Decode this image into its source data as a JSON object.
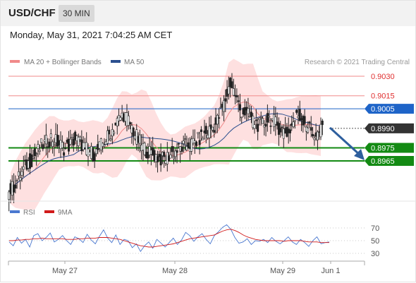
{
  "header": {
    "symbol": "USD/CHF",
    "timeframe": "30 MIN"
  },
  "timestamp": "Monday, May 31, 2021 7:04:25 AM CET",
  "legend": {
    "ma20": "MA 20 + Bollinger Bands",
    "ma50": "MA 50"
  },
  "credit": "Research © 2021 Trading Central",
  "rsi_legend": {
    "rsi": "RSI",
    "ma": "9MA"
  },
  "colors": {
    "resistance": "#f08a8a",
    "pivot_blue": "#1e64c8",
    "support": "#138a13",
    "bollinger": "#fdd5d5",
    "ma20": "#f08a8a",
    "ma50": "#2b4f8f",
    "up": "#1e1e1e",
    "arrow": "#2e5f9e"
  },
  "chart_data": [
    {
      "type": "candlestick",
      "title": "USD/CHF",
      "timeframe": "30 MIN",
      "ylim": [
        0.8935,
        0.904
      ],
      "x_ticks": [
        "May 27",
        "May 28",
        "May 29",
        "Jun 1"
      ],
      "levels": [
        {
          "label": "0.9030",
          "value": 0.903,
          "kind": "resistance"
        },
        {
          "label": "0.9015",
          "value": 0.9015,
          "kind": "resistance"
        },
        {
          "label": "0.9005",
          "value": 0.9005,
          "kind": "pivot"
        },
        {
          "label": "0.8990",
          "value": 0.899,
          "kind": "last"
        },
        {
          "label": "0.8975",
          "value": 0.8975,
          "kind": "support"
        },
        {
          "label": "0.8965",
          "value": 0.8965,
          "kind": "support"
        }
      ],
      "last_price": 0.899,
      "series": [
        {
          "name": "MA 20 + Bollinger Bands"
        },
        {
          "name": "MA 50"
        }
      ],
      "close": [
        0.8944,
        0.895,
        0.8956,
        0.8962,
        0.8966,
        0.8971,
        0.8976,
        0.8979,
        0.8983,
        0.898,
        0.8977,
        0.8974,
        0.8978,
        0.8982,
        0.8979,
        0.8975,
        0.8972,
        0.897,
        0.8975,
        0.898,
        0.8985,
        0.8991,
        0.8997,
        0.9001,
        0.8996,
        0.8988,
        0.8981,
        0.8976,
        0.8972,
        0.897,
        0.8968,
        0.8966,
        0.8968,
        0.8971,
        0.8973,
        0.8975,
        0.8977,
        0.8978,
        0.898,
        0.8983,
        0.8986,
        0.899,
        0.8993,
        0.9002,
        0.9012,
        0.9025,
        0.9016,
        0.9004,
        0.9002,
        0.8999,
        0.8995,
        0.8992,
        0.8994,
        0.8998,
        0.8995,
        0.8991,
        0.8988,
        0.8986,
        0.8995,
        0.9,
        0.8997,
        0.8992,
        0.8986,
        0.8985,
        0.899
      ]
    },
    {
      "type": "line",
      "title": "RSI",
      "ylim": [
        20,
        80
      ],
      "y_ticks": [
        "70",
        "50",
        "30"
      ],
      "series": [
        {
          "name": "RSI",
          "values": [
            48,
            42,
            55,
            46,
            52,
            40,
            58,
            61,
            50,
            55,
            62,
            48,
            52,
            58,
            50,
            44,
            56,
            53,
            47,
            60,
            51,
            45,
            57,
            67,
            54,
            47,
            59,
            44,
            52,
            50,
            39,
            45,
            33,
            42,
            48,
            38,
            52,
            46,
            40,
            47,
            54,
            44,
            51,
            63,
            58,
            49,
            56,
            61,
            52,
            45,
            58,
            64,
            71,
            75,
            68,
            55,
            46,
            48,
            53,
            44,
            50,
            49,
            52,
            47,
            55,
            49,
            45,
            50,
            56,
            48,
            44,
            52,
            47,
            41,
            50,
            56,
            45,
            47,
            48
          ]
        },
        {
          "name": "9MA",
          "values": [
            50,
            50,
            51,
            51,
            52,
            52,
            53,
            53,
            54,
            53,
            53,
            53,
            53,
            53,
            52,
            52,
            52,
            53,
            53,
            54,
            54,
            54,
            55,
            55,
            55,
            54,
            53,
            52,
            50,
            48,
            46,
            44,
            42,
            41,
            40,
            40,
            41,
            42,
            43,
            44,
            45,
            47,
            49,
            51,
            53,
            54,
            55,
            56,
            57,
            58,
            59,
            62,
            65,
            67,
            68,
            66,
            63,
            59,
            56,
            54,
            52,
            51,
            50,
            50,
            50,
            50,
            50,
            49,
            50,
            50,
            50,
            50,
            49,
            48,
            48,
            48,
            47,
            47,
            47
          ]
        }
      ]
    }
  ]
}
